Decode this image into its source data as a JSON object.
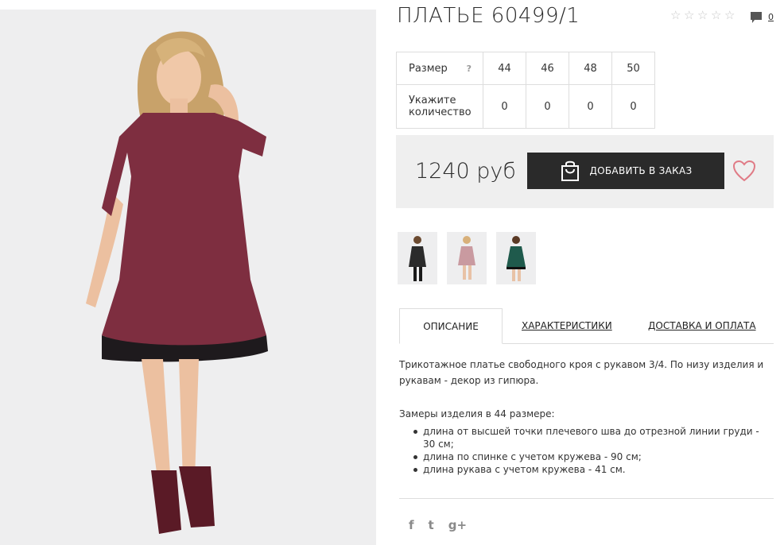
{
  "product": {
    "title": "ПЛАТЬЕ 60499/1",
    "rating_stars": 5,
    "comment_count": "0",
    "photo_alt": "dress photo"
  },
  "sizes": {
    "size_label": "Размер",
    "help_icon": "?",
    "qty_label_line1": "Укажите",
    "qty_label_line2": "количество",
    "items": [
      {
        "size": "44",
        "qty": "0"
      },
      {
        "size": "46",
        "qty": "0"
      },
      {
        "size": "48",
        "qty": "0"
      },
      {
        "size": "50",
        "qty": "0"
      }
    ]
  },
  "purchase": {
    "price": "1240 руб",
    "add_button": "ДОБАВИТЬ В ЗАКАЗ",
    "accent_color": "#e07b86",
    "button_color": "#2a2a2a"
  },
  "thumbnails": [
    {
      "name": "thumb-black",
      "color": "#2b2b2b"
    },
    {
      "name": "thumb-pink",
      "color": "#c99aa0"
    },
    {
      "name": "thumb-green",
      "color": "#1f5a4c"
    }
  ],
  "tabs": {
    "description": "ОПИСАНИЕ",
    "characteristics": "ХАРАКТЕРИСТИКИ",
    "delivery": "ДОСТАВКА И ОПЛАТА"
  },
  "description": {
    "text": "Трикотажное платье свободного кроя с рукавом 3/4. По низу изделия и рукавам - декор из гипюра.",
    "measures_title": "Замеры изделия в 44 размере:",
    "measures": [
      "длина от высшей точки плечевого шва до отрезной линии груди - 30 см;",
      "длина по спинке с учетом кружева - 90 см;",
      "длина рукава с учетом кружева - 41 см."
    ]
  },
  "social": {
    "facebook": "f",
    "twitter": "t",
    "google": "g+"
  }
}
